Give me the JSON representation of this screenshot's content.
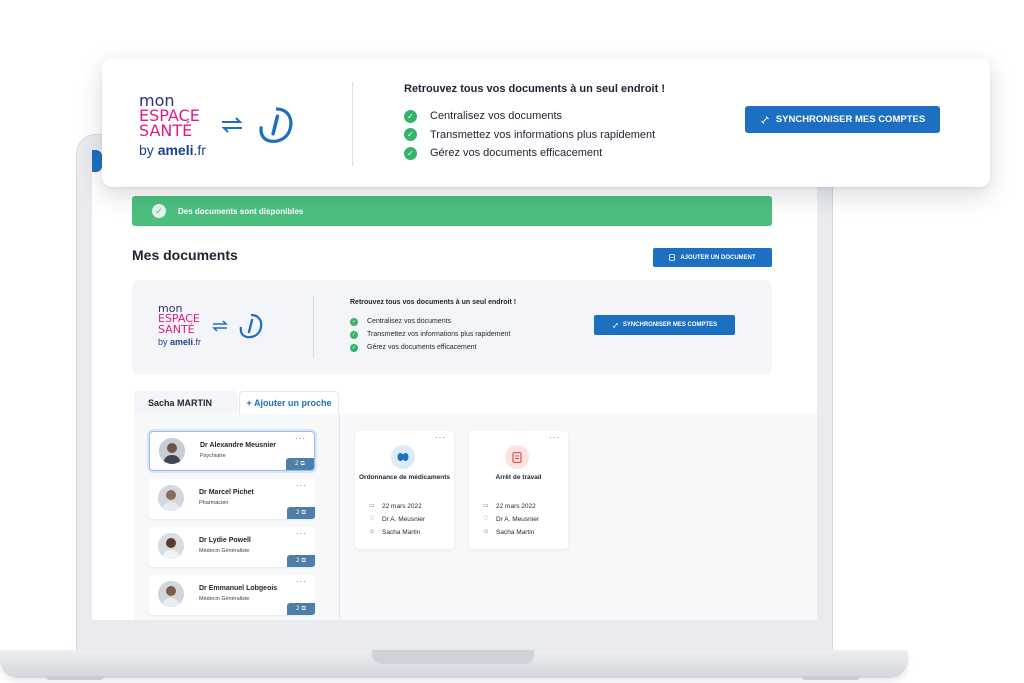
{
  "alert": {
    "text": "Des documents sont disponibles"
  },
  "page": {
    "title": "Mes documents",
    "add_document_label": "AJOUTER UN DOCUMENT"
  },
  "sync_card": {
    "logo": {
      "line1": "mon",
      "line2": "ESPACE",
      "line3": "SANTÉ",
      "by": "by",
      "brand": "ameli",
      "tld": ".fr"
    },
    "headline": "Retrouvez tous vos documents à un seul endroit !",
    "benefits": [
      "Centralisez vos documents",
      "Transmettez vos informations plus rapidement",
      "Gérez vos documents efficacement"
    ],
    "sync_label": "SYNCHRONISER MES COMPTES"
  },
  "tabs": {
    "active": "Sacha MARTIN",
    "add": "+ Ajouter un proche"
  },
  "contacts": [
    {
      "name": "Dr Alexandre Meusnier",
      "role": "Psychiatre",
      "count": "2"
    },
    {
      "name": "Dr Marcel Pichet",
      "role": "Pharmacien",
      "count": "2"
    },
    {
      "name": "Dr Lydie Powell",
      "role": "Médecin Généraliste",
      "count": "2"
    },
    {
      "name": "Dr Emmanuel Lobgeois",
      "role": "Médecin Généraliste",
      "count": "2"
    }
  ],
  "documents": [
    {
      "title": "Ordonnance de médicaments",
      "date": "22 mars 2022",
      "doctor": "Dr A. Meusnier",
      "patient": "Sacha Martin",
      "icon": "pills-icon"
    },
    {
      "title": "Arrêt de travail",
      "date": "22 mars 2022",
      "doctor": "Dr A. Meusnier",
      "patient": "Sacha Martin",
      "icon": "document-icon"
    }
  ],
  "more_menu": "···",
  "colors": {
    "primary": "#1d6fc1",
    "success": "#4cbf7e",
    "brand_blue": "#2b2d84",
    "brand_pink": "#e0198a"
  }
}
